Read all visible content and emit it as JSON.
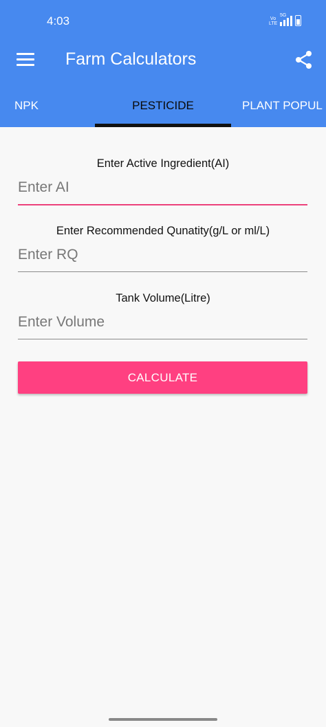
{
  "status": {
    "time": "4:03",
    "volte_label": "Vo LTE",
    "network_label": "5G"
  },
  "app": {
    "title": "Farm Calculators",
    "primary_color": "#4789ef",
    "accent_color": "#ff4081",
    "icons": {
      "menu": "hamburger-menu-icon",
      "share": "share-icon"
    }
  },
  "tabs": [
    {
      "label": "NPK",
      "selected": false
    },
    {
      "label": "PESTICIDE",
      "selected": true
    },
    {
      "label": "PLANT POPUL",
      "selected": false
    }
  ],
  "form": {
    "ai_label": "Enter Active Ingredient(AI)",
    "ai_placeholder": "Enter AI",
    "rq_label": "Enter Recommended Qunatity(g/L or ml/L)",
    "rq_placeholder": "Enter RQ",
    "volume_label": "Tank Volume(Litre)",
    "volume_placeholder": "Enter Volume",
    "calculate_label": "CALCULATE"
  }
}
